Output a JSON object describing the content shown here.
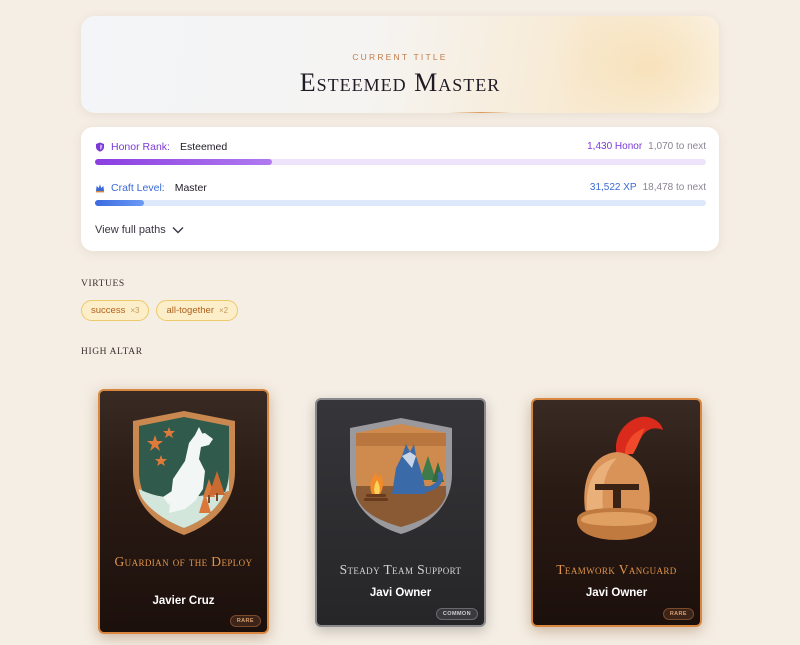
{
  "title_card": {
    "eyebrow": "CURRENT TITLE",
    "title": "Esteemed Master"
  },
  "progress": {
    "honor": {
      "label": "Honor Rank:",
      "value": "Esteemed",
      "amount": "1,430 Honor",
      "to_next": "1,070 to next",
      "fill_fraction": 0.29,
      "color": "#7b3ad6",
      "icon": "shield-icon"
    },
    "craft": {
      "label": "Craft Level:",
      "value": "Master",
      "amount": "31,522 XP",
      "to_next": "18,478 to next",
      "fill_fraction": 0.08,
      "color": "#3a6ad6",
      "icon": "crown-icon"
    },
    "view_paths": "View full paths"
  },
  "virtues": {
    "heading": "VIRTUES",
    "chips": [
      {
        "label": "success",
        "count": "×3"
      },
      {
        "label": "all-together",
        "count": "×2"
      }
    ]
  },
  "altar": {
    "heading": "HIGH ALTAR",
    "badges": [
      {
        "name": "Guardian of the Deploy",
        "owner": "Javier Cruz",
        "rarity": "RARE",
        "art": "howling-wolf-shield-icon"
      },
      {
        "name": "Steady Team Support",
        "owner": "Javi Owner",
        "rarity": "COMMON",
        "art": "wolf-campfire-shield-icon"
      },
      {
        "name": "Teamwork Vanguard",
        "owner": "Javi Owner",
        "rarity": "RARE",
        "art": "spartan-helmet-icon"
      }
    ]
  }
}
